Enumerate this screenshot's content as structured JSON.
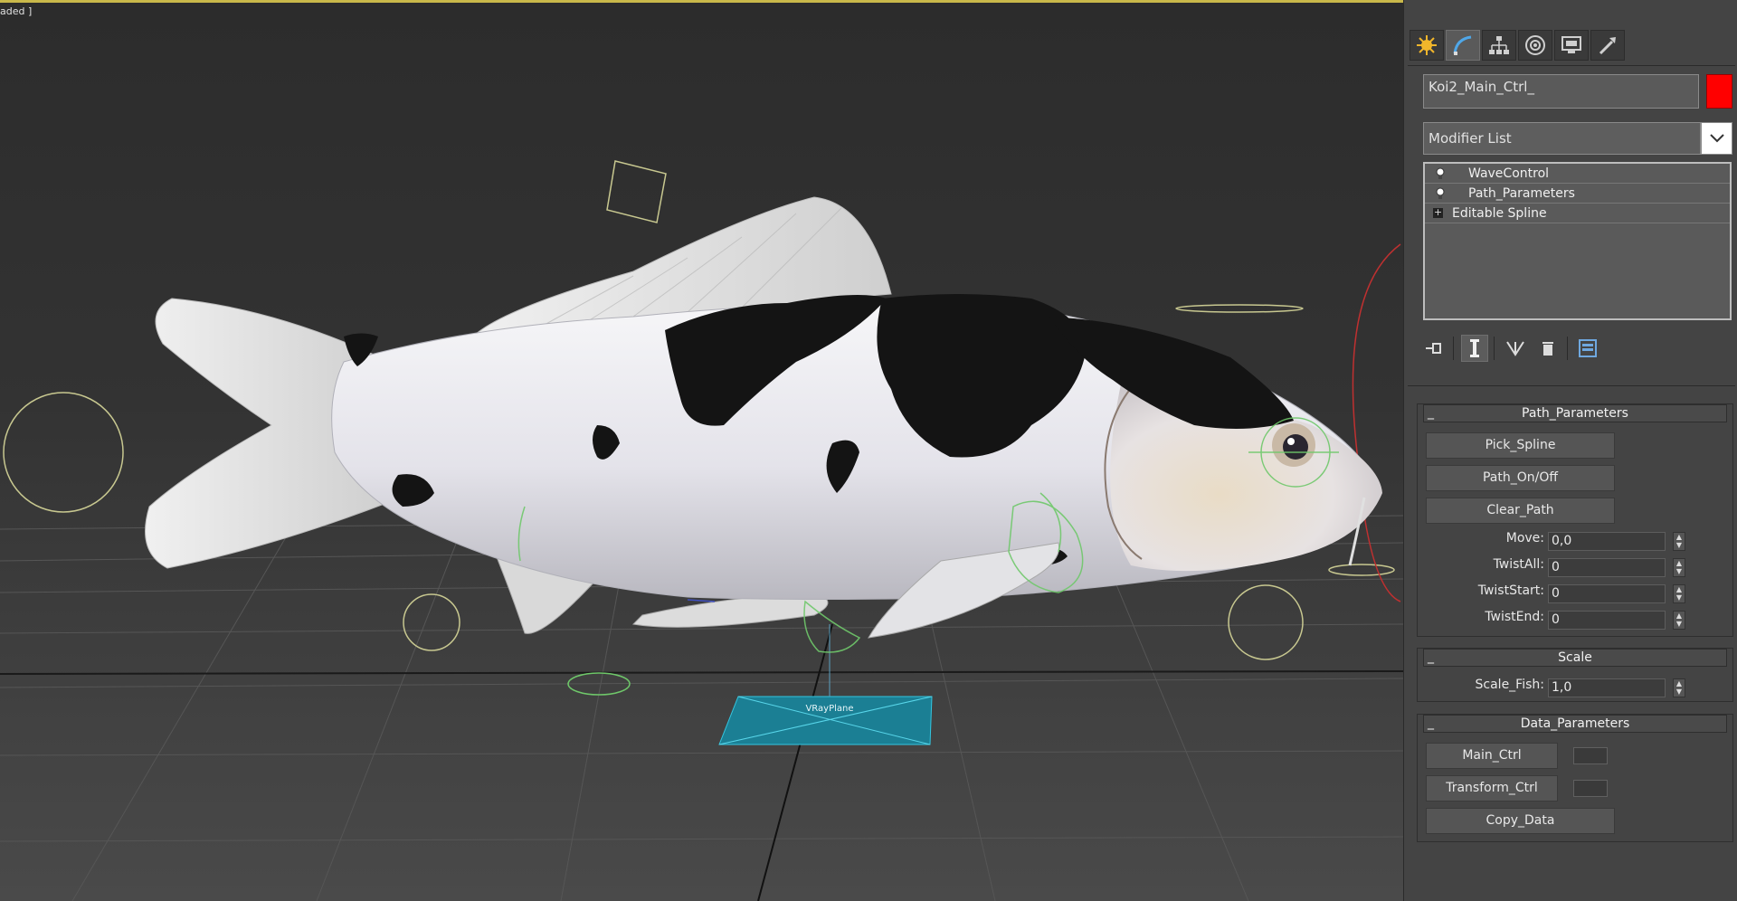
{
  "viewport": {
    "label": "aded ]",
    "plane_label": "VRayPlane"
  },
  "command_panel": {
    "tabs": [
      {
        "name": "create",
        "icon": "create-icon"
      },
      {
        "name": "modify",
        "icon": "modify-icon",
        "active": true
      },
      {
        "name": "hierarchy",
        "icon": "hierarchy-icon"
      },
      {
        "name": "motion",
        "icon": "motion-icon"
      },
      {
        "name": "display",
        "icon": "display-icon"
      },
      {
        "name": "utilities",
        "icon": "utilities-icon"
      }
    ],
    "object_name": "Koi2_Main_Ctrl_",
    "object_color": "#ff0000",
    "modifier_list_label": "Modifier List",
    "stack": [
      {
        "label": "WaveControl",
        "icon": "lightbulb-icon"
      },
      {
        "label": "Path_Parameters",
        "icon": "lightbulb-icon"
      },
      {
        "label": "Editable Spline",
        "icon": "expand-plus-icon"
      }
    ],
    "stack_tools": [
      "pin-stack-icon",
      "show-end-result-icon",
      "make-unique-icon",
      "remove-modifier-icon",
      "configure-sets-icon"
    ]
  },
  "rollouts": {
    "path_parameters": {
      "title": "Path_Parameters",
      "collapse": "_",
      "buttons": {
        "pick_spline": "Pick_Spline",
        "path_onoff": "Path_On/Off",
        "clear_path": "Clear_Path"
      },
      "params": {
        "move_label": "Move:",
        "move_value": "0,0",
        "twistall_label": "TwistAll:",
        "twistall_value": "0",
        "twiststart_label": "TwistStart:",
        "twiststart_value": "0",
        "twistend_label": "TwistEnd:",
        "twistend_value": "0"
      }
    },
    "scale": {
      "title": "Scale",
      "collapse": "_",
      "scale_fish_label": "Scale_Fish:",
      "scale_fish_value": "1,0"
    },
    "data_parameters": {
      "title": "Data_Parameters",
      "collapse": "_",
      "main_ctrl": "Main_Ctrl",
      "transform_ctrl": "Transform_Ctrl",
      "copy_data": "Copy_Data"
    }
  },
  "colors": {
    "viewport_border": "#c9b84a",
    "helper_yellow": "#c8c890",
    "helper_green": "#6fc86a",
    "spline_red": "#c03030",
    "vray_plane": "#1b7f94"
  }
}
